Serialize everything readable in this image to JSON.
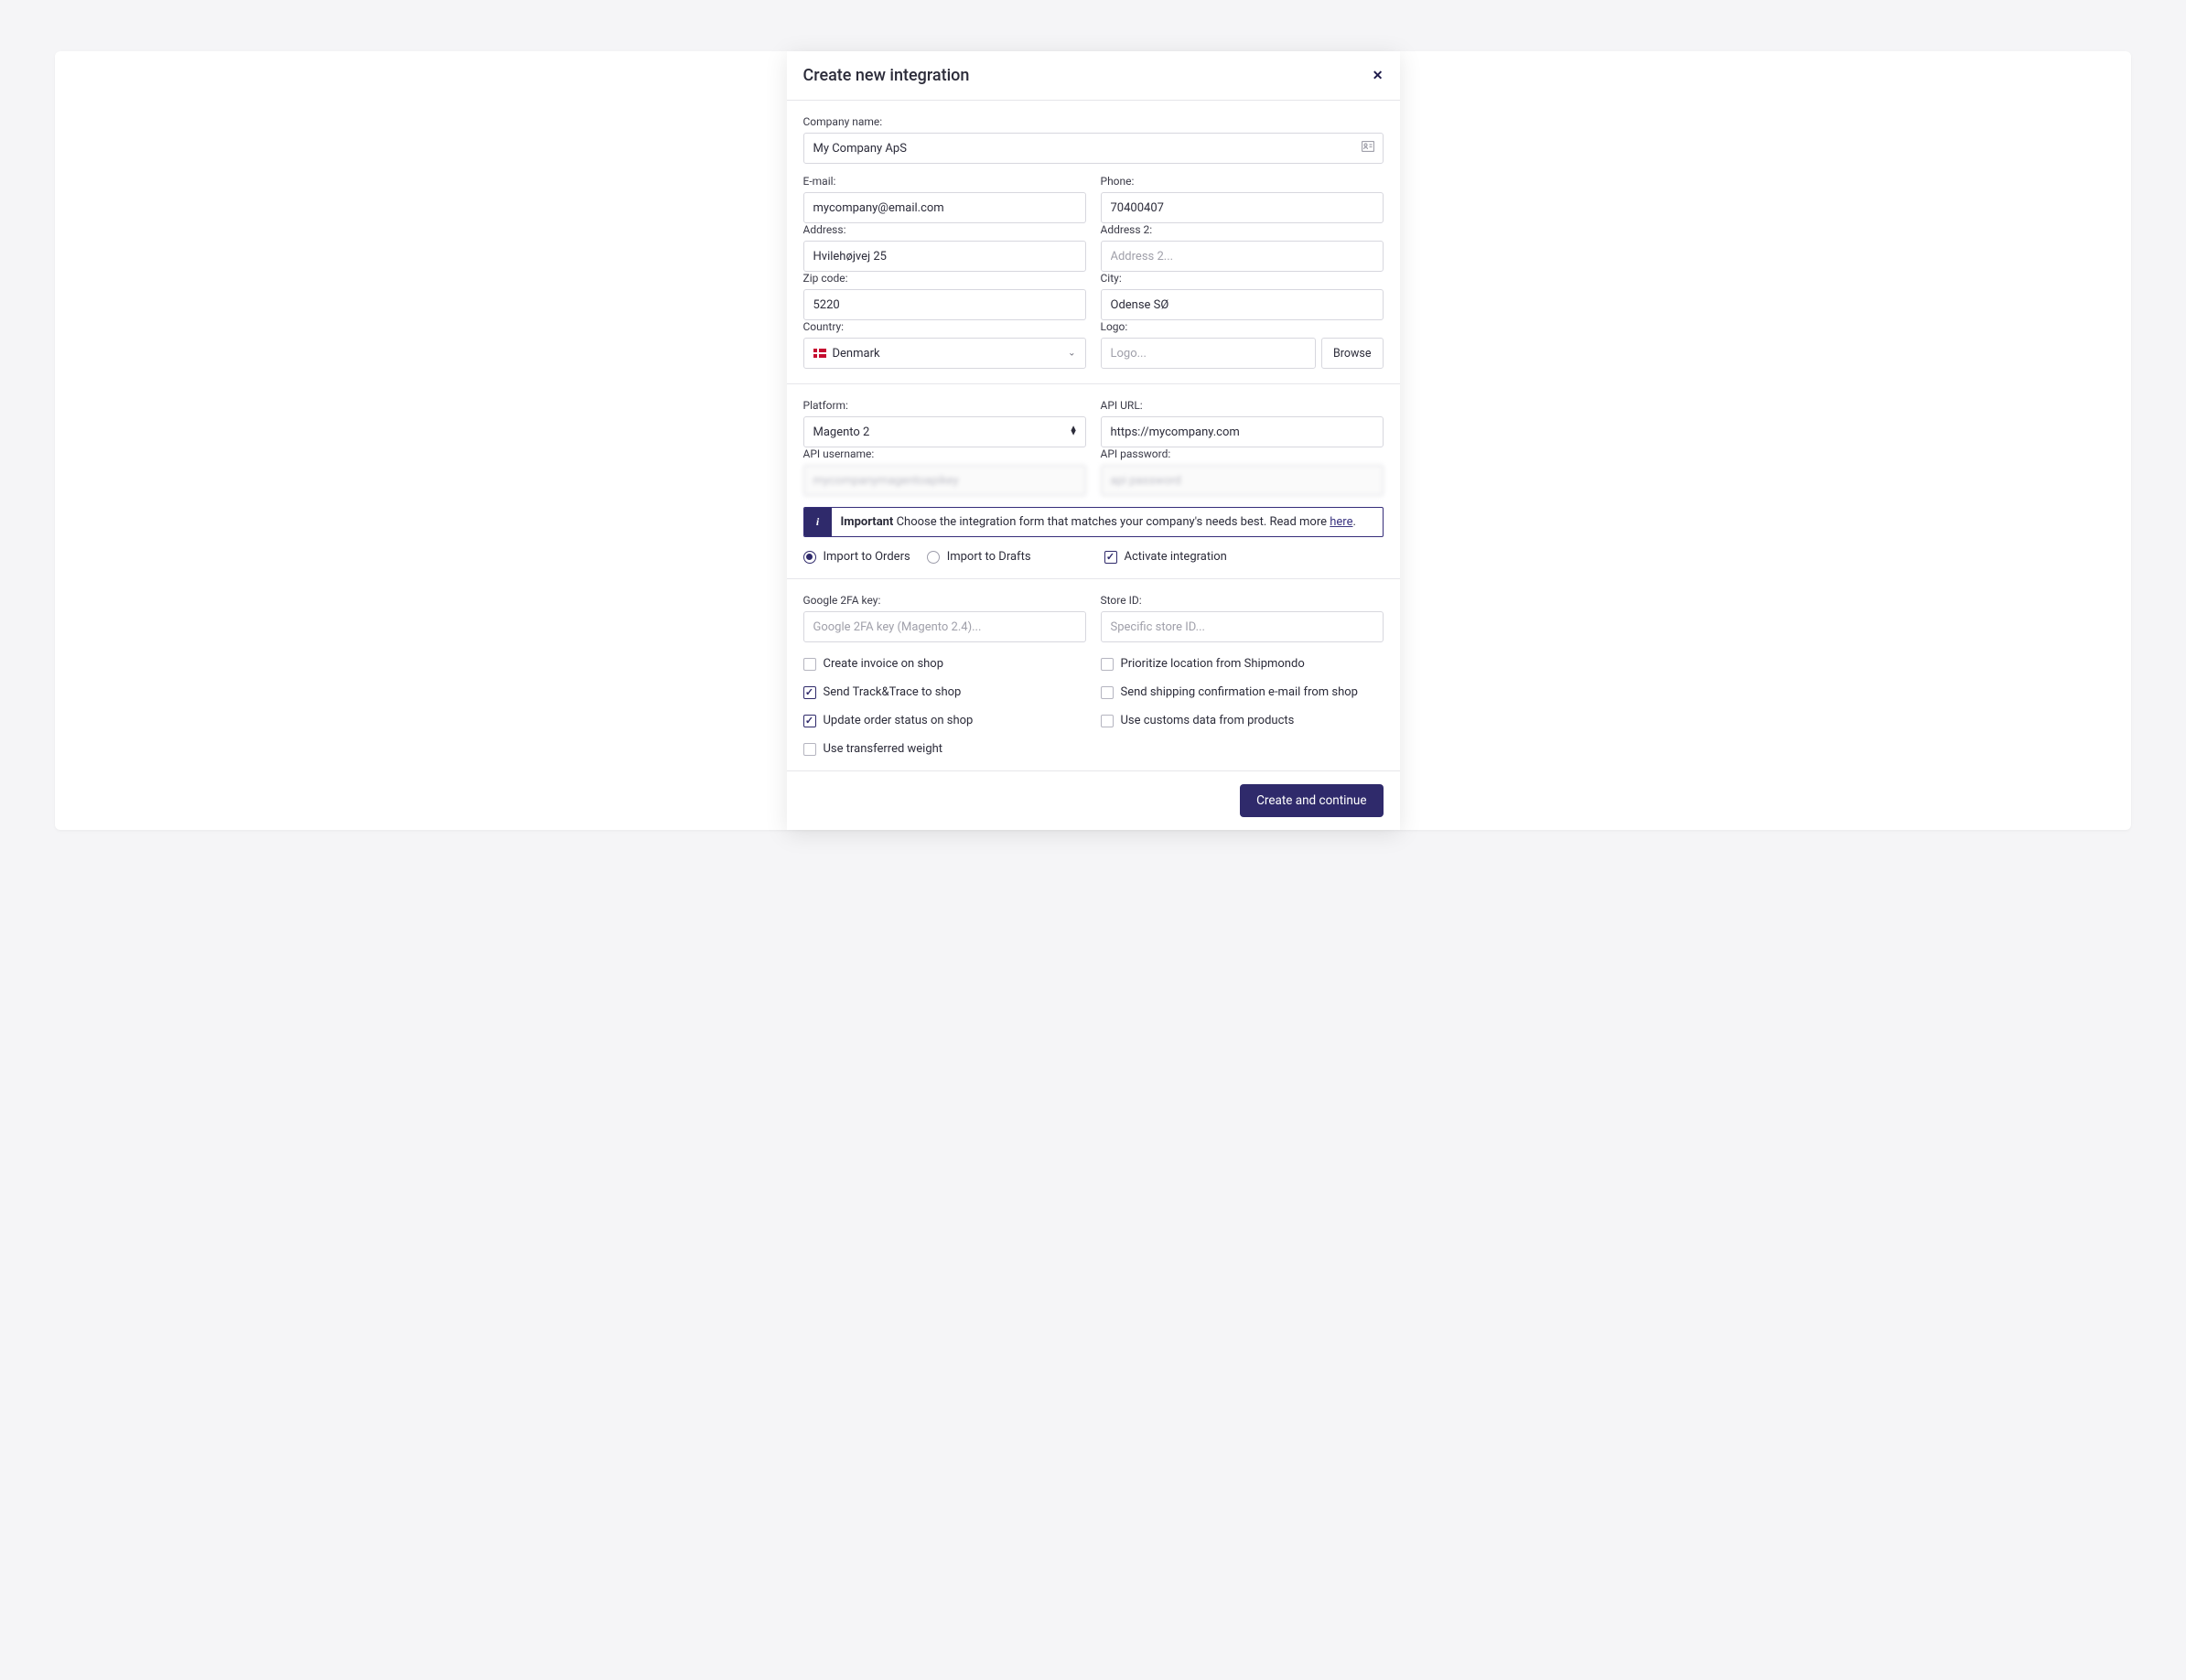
{
  "modal": {
    "title": "Create new integration",
    "close": "✕",
    "company": {
      "label": "Company name:",
      "value": "My Company ApS"
    },
    "email": {
      "label": "E-mail:",
      "value": "mycompany@email.com"
    },
    "phone": {
      "label": "Phone:",
      "value": "70400407"
    },
    "address": {
      "label": "Address:",
      "value": "Hvilehøjvej 25"
    },
    "address2": {
      "label": "Address 2:",
      "placeholder": "Address 2...",
      "value": ""
    },
    "zip": {
      "label": "Zip code:",
      "value": "5220"
    },
    "city": {
      "label": "City:",
      "value": "Odense SØ"
    },
    "country": {
      "label": "Country:",
      "value": "Denmark"
    },
    "logo": {
      "label": "Logo:",
      "placeholder": "Logo...",
      "browse": "Browse"
    },
    "platform": {
      "label": "Platform:",
      "value": "Magento 2"
    },
    "api_url": {
      "label": "API URL:",
      "value": "https://mycompany.com"
    },
    "api_username": {
      "label": "API username:",
      "masked": "mycompanymagentoapikey"
    },
    "api_password": {
      "label": "API password:",
      "masked": "api password"
    },
    "info": {
      "strong": "Important",
      "text": " Choose the integration form that matches your company's needs best. Read more ",
      "link": "here",
      "period": "."
    },
    "import_orders": "Import to Orders",
    "import_drafts": "Import to Drafts",
    "activate": "Activate integration",
    "google_2fa": {
      "label": "Google 2FA key:",
      "placeholder": "Google 2FA key (Magento 2.4)..."
    },
    "store_id": {
      "label": "Store ID:",
      "placeholder": "Specific store ID..."
    },
    "checks": {
      "create_invoice": "Create invoice on shop",
      "send_track": "Send Track&Trace to shop",
      "update_status": "Update order status on shop",
      "use_weight": "Use transferred weight",
      "prioritize_location": "Prioritize location from Shipmondo",
      "send_confirmation": "Send shipping confirmation e-mail from shop",
      "use_customs": "Use customs data from products"
    },
    "submit": "Create and continue"
  }
}
